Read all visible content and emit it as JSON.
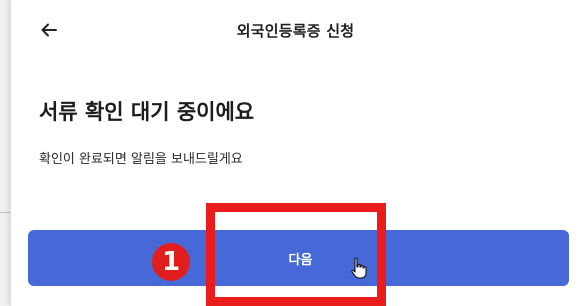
{
  "header": {
    "back_icon": "arrow-left-icon",
    "title": "외국인등록증 신청"
  },
  "main": {
    "heading": "서류 확인 대기 중이에요",
    "message": "확인이 완료되면 알림을 보내드릴게요"
  },
  "actions": {
    "next_label": "다음"
  },
  "annotation": {
    "step_number": "1",
    "highlight_color": "#ea1c1c"
  },
  "colors": {
    "primary_button": "#4769d8",
    "text": "#1c1c1c",
    "background": "#ffffff"
  }
}
